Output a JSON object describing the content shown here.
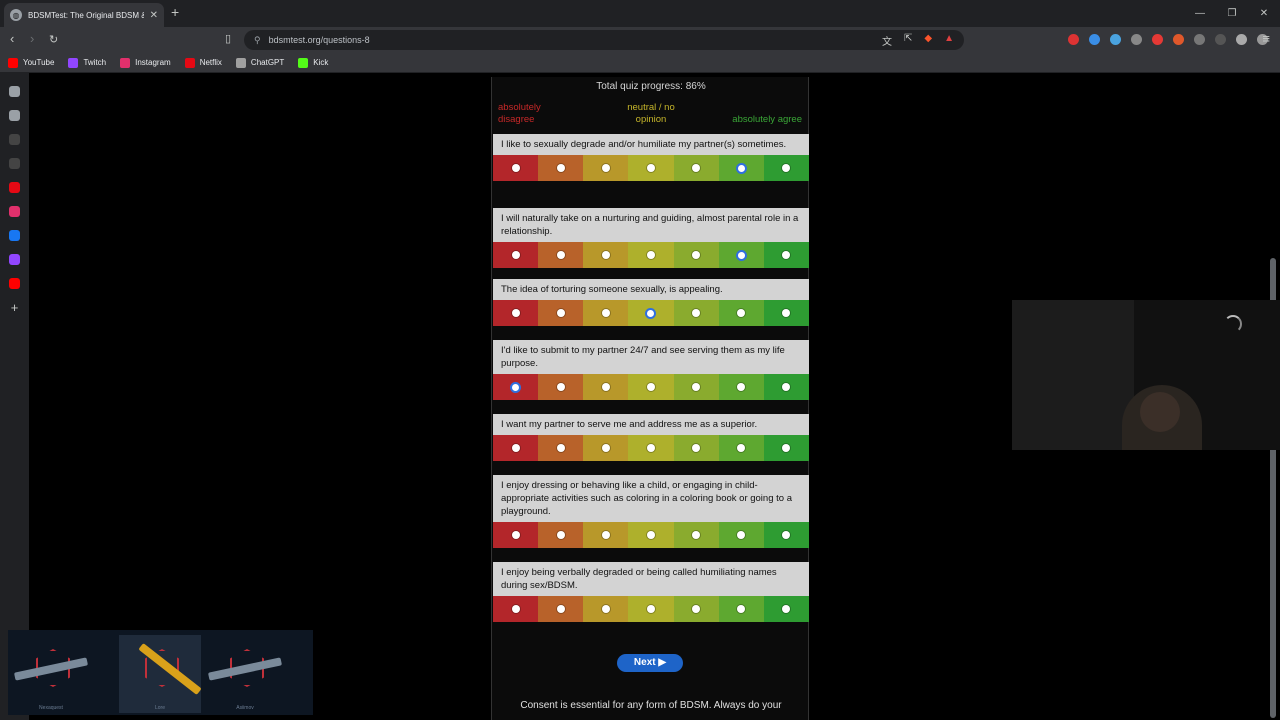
{
  "browser": {
    "tab_title": "BDSMTest: The Original BDSM &",
    "url": "bdsmtest.org/questions-8",
    "bookmarks": [
      {
        "label": "YouTube",
        "color": "#ff0000"
      },
      {
        "label": "Twitch",
        "color": "#9146ff"
      },
      {
        "label": "Instagram",
        "color": "#e1306c"
      },
      {
        "label": "Netflix",
        "color": "#e50914"
      },
      {
        "label": "ChatGPT",
        "color": "#a0a0a0"
      },
      {
        "label": "Kick",
        "color": "#53fc18"
      }
    ]
  },
  "quiz": {
    "progress_text": "Total quiz progress: 86%",
    "scale": {
      "disagree": "absolutely disagree",
      "neutral": "neutral / no opinion",
      "agree": "absolutely agree"
    },
    "questions": [
      {
        "text": "I like to sexually degrade and/or humiliate my partner(s) sometimes.",
        "selected": 5
      },
      {
        "text": "I will naturally take on a nurturing and guiding, almost parental role in a relationship.",
        "selected": 5
      },
      {
        "text": "The idea of torturing someone sexually, is appealing.",
        "selected": 3
      },
      {
        "text": "I'd like to submit to my partner 24/7 and see serving them as my life purpose.",
        "selected": 0
      },
      {
        "text": "I want my partner to serve me and address me as a superior.",
        "selected": null
      },
      {
        "text": "I enjoy dressing or behaving like a child, or engaging in child-appropriate activities such as coloring in a coloring book or going to a playground.",
        "selected": null
      },
      {
        "text": "I enjoy being verbally degraded or being called humiliating names during sex/BDSM.",
        "selected": null
      }
    ],
    "next_label": "Next ▶",
    "consent_text": "Consent is essential for any form of BDSM. Always do your"
  },
  "overlay": {
    "skins": [
      {
        "name": "Nexaquest"
      },
      {
        "name": "Lore"
      },
      {
        "name": "Asiimov"
      }
    ]
  }
}
